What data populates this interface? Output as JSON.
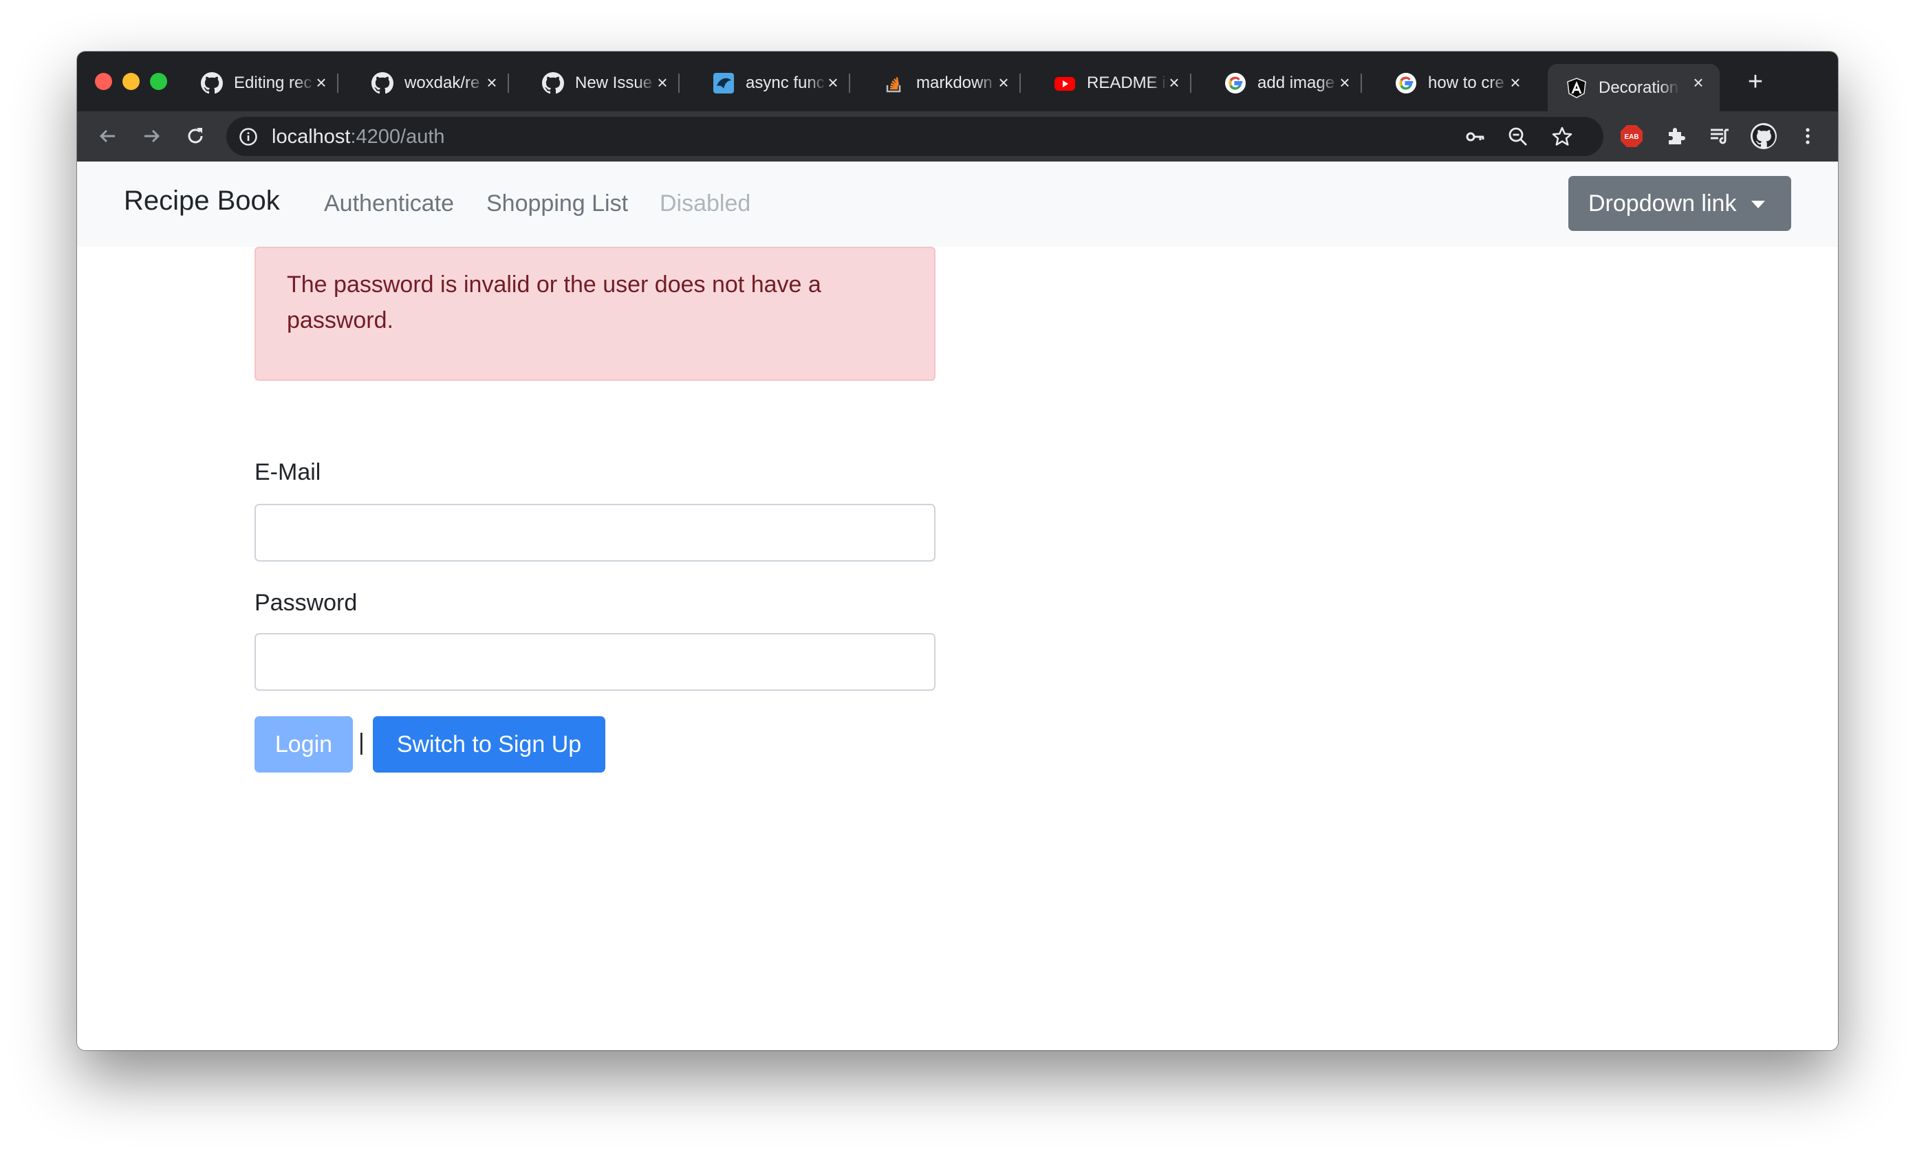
{
  "browser": {
    "tabs": [
      {
        "title": "Editing rec",
        "icon": "github-icon"
      },
      {
        "title": "woxdak/re",
        "icon": "github-icon"
      },
      {
        "title": "New Issue",
        "icon": "github-icon"
      },
      {
        "title": "async func",
        "icon": "blue-logo-icon"
      },
      {
        "title": "markdown",
        "icon": "stackoverflow-icon"
      },
      {
        "title": "README ir",
        "icon": "youtube-icon"
      },
      {
        "title": "add image",
        "icon": "google-icon"
      },
      {
        "title": "how to cre",
        "icon": "google-icon"
      },
      {
        "title": "Decoration",
        "icon": "angular-icon",
        "active": true
      }
    ],
    "address": {
      "host": "localhost",
      "rest": ":4200/auth"
    },
    "extension_badge": "EAB"
  },
  "navbar": {
    "brand": "Recipe Book",
    "links": [
      "Authenticate",
      "Shopping List",
      "Disabled"
    ],
    "dropdown_label": "Dropdown link"
  },
  "alert": {
    "message": "The password is invalid or the user does not have a password."
  },
  "form": {
    "email_label": "E-Mail",
    "email_value": "",
    "password_label": "Password",
    "password_value": "",
    "login_label": "Login",
    "separator": "|",
    "switch_label": "Switch to Sign Up"
  },
  "colors": {
    "alert_bg": "#f8d7da",
    "alert_text": "#721c24",
    "primary": "#2b7ff0",
    "primary_disabled": "#80b3ff",
    "secondary": "#6c757d"
  }
}
